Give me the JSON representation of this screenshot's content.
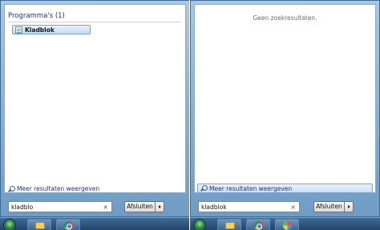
{
  "left_menu": {
    "group_header": "Programma's (1)",
    "results": [
      {
        "label": "Kladblok",
        "icon": "notepad-icon"
      }
    ],
    "more_results": "Meer resultaten weergeven",
    "search": {
      "value": "kladblo",
      "clear_glyph": "×"
    },
    "shutdown": {
      "label": "Afsluiten"
    }
  },
  "right_menu": {
    "no_results": "Geen zoekresultaten.",
    "more_results": "Meer resultaten weergeven",
    "search": {
      "value": "kladblok",
      "clear_glyph": "×"
    },
    "shutdown": {
      "label": "Afsluiten"
    }
  },
  "taskbar": {
    "left_items": [
      "start-orb",
      "explorer-icon",
      "chrome-icon"
    ],
    "right_items": [
      "start-orb",
      "explorer-icon",
      "chrome-icon",
      "paint-icon"
    ]
  },
  "colors": {
    "accent_text": "#1e3287",
    "frame": "#6f9cc4",
    "taskbar": "#22456b"
  }
}
